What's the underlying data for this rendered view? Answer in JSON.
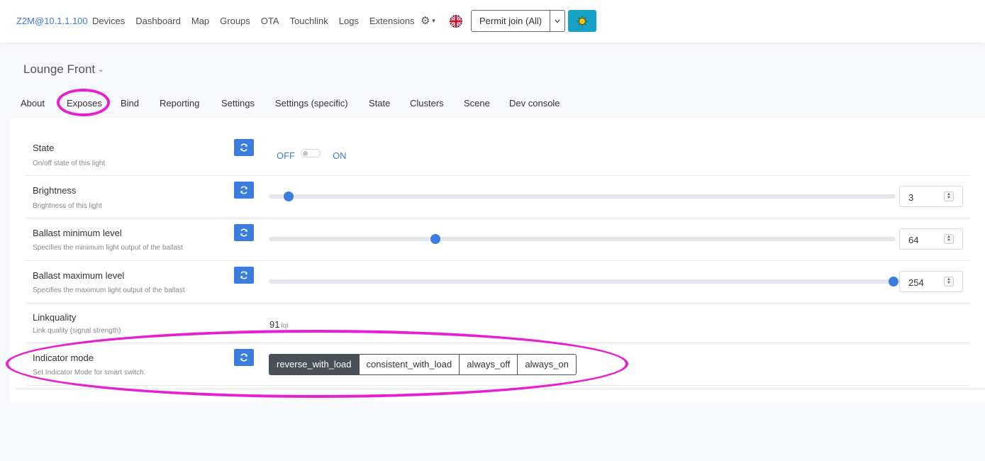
{
  "navbar": {
    "brand": "Z2M@10.1.1.100",
    "items": [
      "Devices",
      "Dashboard",
      "Map",
      "Groups",
      "OTA",
      "Touchlink",
      "Logs",
      "Extensions"
    ],
    "settings_icon": "gear-icon",
    "language_icon": "uk-flag-icon",
    "permit_join_label": "Permit join (All)",
    "theme_icon": "sun-icon"
  },
  "device": {
    "name": "Lounge Front"
  },
  "tabs": [
    "About",
    "Exposes",
    "Bind",
    "Reporting",
    "Settings",
    "Settings (specific)",
    "State",
    "Clusters",
    "Scene",
    "Dev console"
  ],
  "active_tab": "Exposes",
  "exposes": {
    "state": {
      "label": "State",
      "description": "On/off state of this light",
      "off_label": "OFF",
      "on_label": "ON",
      "value": "OFF"
    },
    "brightness": {
      "label": "Brightness",
      "description": "Brightness of this light",
      "value": "3",
      "fraction": 0.012
    },
    "ballast_min": {
      "label": "Ballast minimum level",
      "description": "Specifies the minimum light output of the ballast",
      "value": "64",
      "fraction": 0.252
    },
    "ballast_max": {
      "label": "Ballast maximum level",
      "description": "Specifies the maximum light output of the ballast",
      "value": "254",
      "fraction": 1.0
    },
    "linkquality": {
      "label": "Linkquality",
      "description": "Link quality (signal strength)",
      "value": "91",
      "unit": "lqi"
    },
    "indicator_mode": {
      "label": "Indicator mode",
      "description": "Set Indicator Mode for smart switch.",
      "options": [
        "reverse_with_load",
        "consistent_with_load",
        "always_off",
        "always_on"
      ],
      "selected": "reverse_with_load"
    }
  },
  "colors": {
    "accent": "#3b7ddd",
    "highlight": "#e61fd3",
    "theme_button": "#17a2c8",
    "selected_option": "#495057"
  }
}
